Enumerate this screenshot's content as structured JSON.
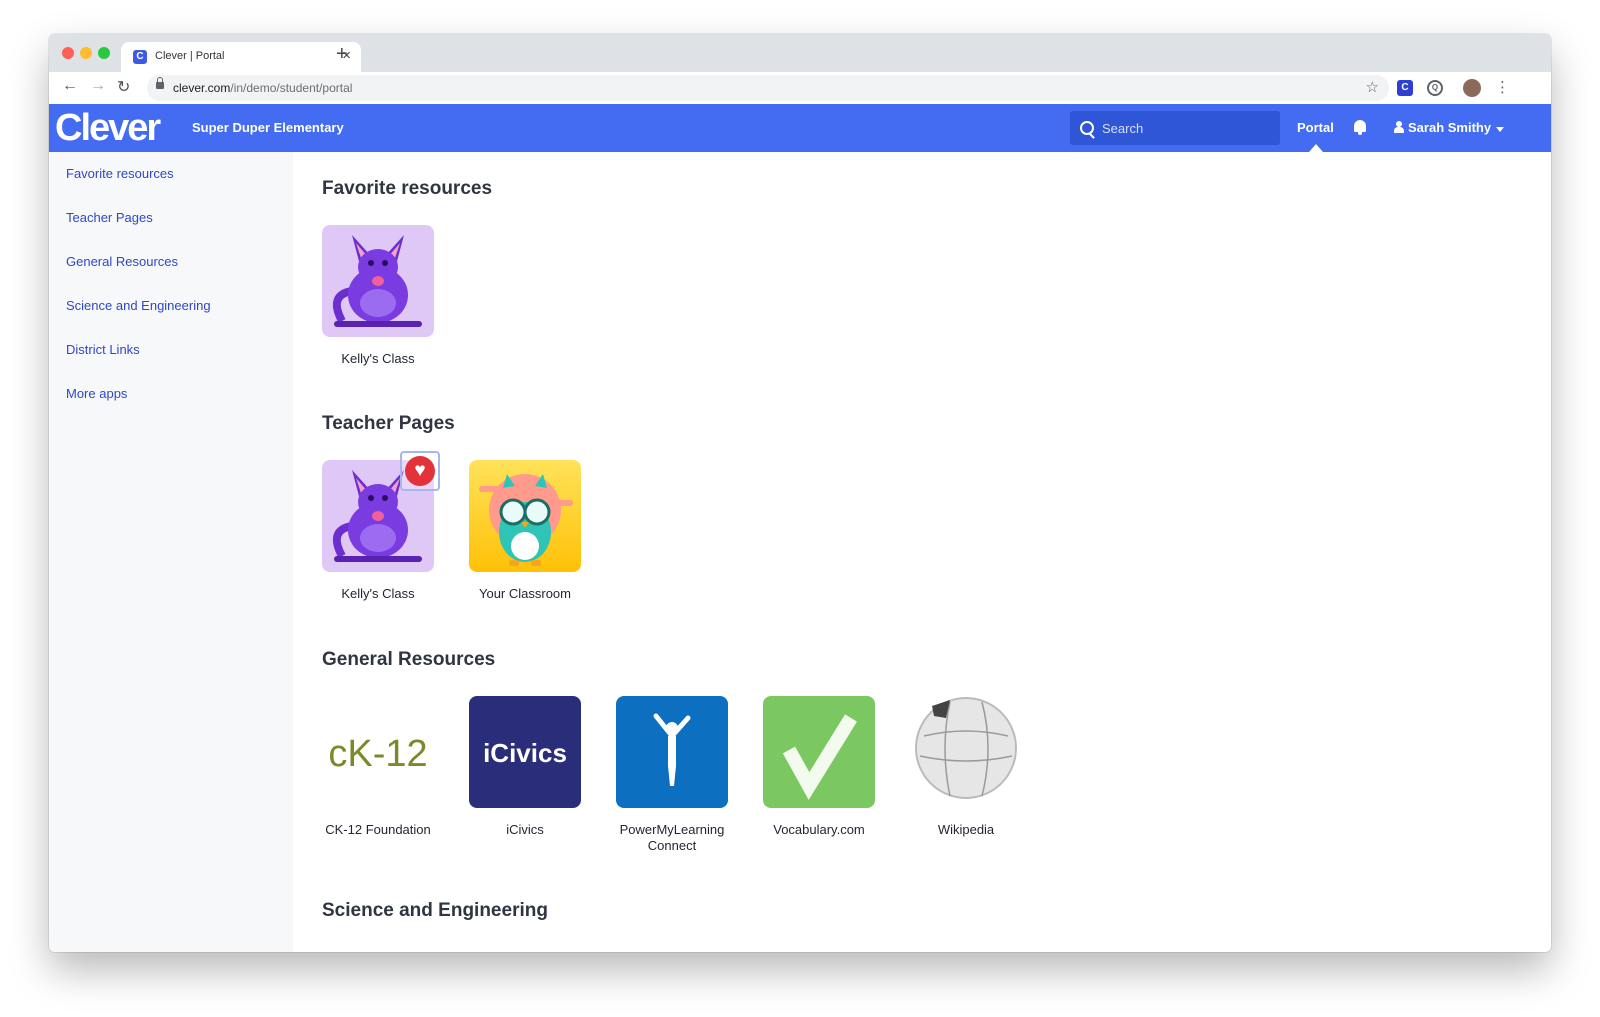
{
  "browser": {
    "tab_title": "Clever | Portal",
    "tab_favicon": "C",
    "new_tab": "+",
    "close": "×",
    "url_host": "clever.com",
    "url_path": "/in/demo/student/portal",
    "extension_1": "C",
    "extension_2": "Q"
  },
  "header": {
    "logo": "Clever",
    "school": "Super Duper Elementary",
    "search_placeholder": "Search",
    "portal": "Portal",
    "user": "Sarah Smithy",
    "brand_color": "#436cf2"
  },
  "sidebar": {
    "items": [
      {
        "label": "Favorite resources"
      },
      {
        "label": "Teacher Pages"
      },
      {
        "label": "General Resources"
      },
      {
        "label": "Science and Engineering"
      },
      {
        "label": "District Links"
      },
      {
        "label": "More apps"
      }
    ]
  },
  "sections": [
    {
      "title": "Favorite resources",
      "apps": [
        {
          "label": "Kelly's Class",
          "icon": "kangaroo-icon"
        }
      ]
    },
    {
      "title": "Teacher Pages",
      "apps": [
        {
          "label": "Kelly's Class",
          "icon": "kangaroo-icon",
          "favorite_heart": true
        },
        {
          "label": "Your Classroom",
          "icon": "owl-icon"
        }
      ]
    },
    {
      "title": "General Resources",
      "apps": [
        {
          "label": "CK-12 Foundation",
          "icon": "ck12-logo",
          "logo_text": "cK-12"
        },
        {
          "label": "iCivics",
          "icon": "icivics-logo",
          "logo_text": "iCivics"
        },
        {
          "label": "PowerMyLearning Connect",
          "icon": "powermylearning-logo"
        },
        {
          "label": "Vocabulary.com",
          "icon": "vocabulary-checkmark-logo"
        },
        {
          "label": "Wikipedia",
          "icon": "wikipedia-globe-logo"
        }
      ]
    },
    {
      "title": "Science and Engineering",
      "apps": []
    }
  ]
}
